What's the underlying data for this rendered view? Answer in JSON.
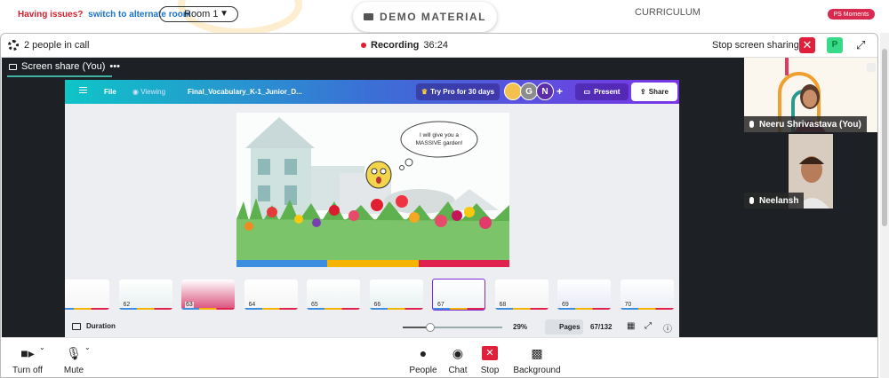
{
  "top_bar": {
    "issues_text": "Having issues?",
    "alternate_room_link": "switch to alternate room",
    "room_select": "Room 1",
    "demo_material": "DEMO MATERIAL",
    "curriculum": "CURRICULUM",
    "ps_moments": "PS Moments"
  },
  "call_bar": {
    "people_count": "2 people in call",
    "recording_label": "Recording",
    "recording_time": "36:24",
    "stop_sharing": "Stop screen sharing",
    "p_badge": "P"
  },
  "screen_share_tab": "Screen share (You)",
  "canva": {
    "file": "File",
    "viewing": "Viewing",
    "doc_title": "Final_Vocabulary_K-1_Junior_D...",
    "try_pro": "Try Pro for 30 days",
    "avatars": [
      "",
      "G",
      "N"
    ],
    "present": "Present",
    "share": "Share",
    "slide_bubble": "I will give you a MASSIVE garden!",
    "thumbnails": [
      "",
      "62",
      "63",
      "64",
      "65",
      "66",
      "67",
      "68",
      "69",
      "70",
      ""
    ],
    "selected_page": "67",
    "duration": "Duration",
    "zoom": "29%",
    "zoom_level": 0.29,
    "pages": "Pages",
    "page_count": "67/132"
  },
  "participants": [
    {
      "name": "Neeru Shrivastava (You)"
    },
    {
      "name": "Neelansh"
    }
  ],
  "controls": {
    "turn_off": "Turn off",
    "mute": "Mute",
    "people": "People",
    "chat": "Chat",
    "stop": "Stop",
    "background": "Background"
  },
  "colors": {
    "recording": "#e02030",
    "stop_share": "#e0203a",
    "canva_gradient_start": "#0ec5c7",
    "canva_gradient_end": "#7a34e6",
    "tab_underline": "#3fb2a4"
  }
}
